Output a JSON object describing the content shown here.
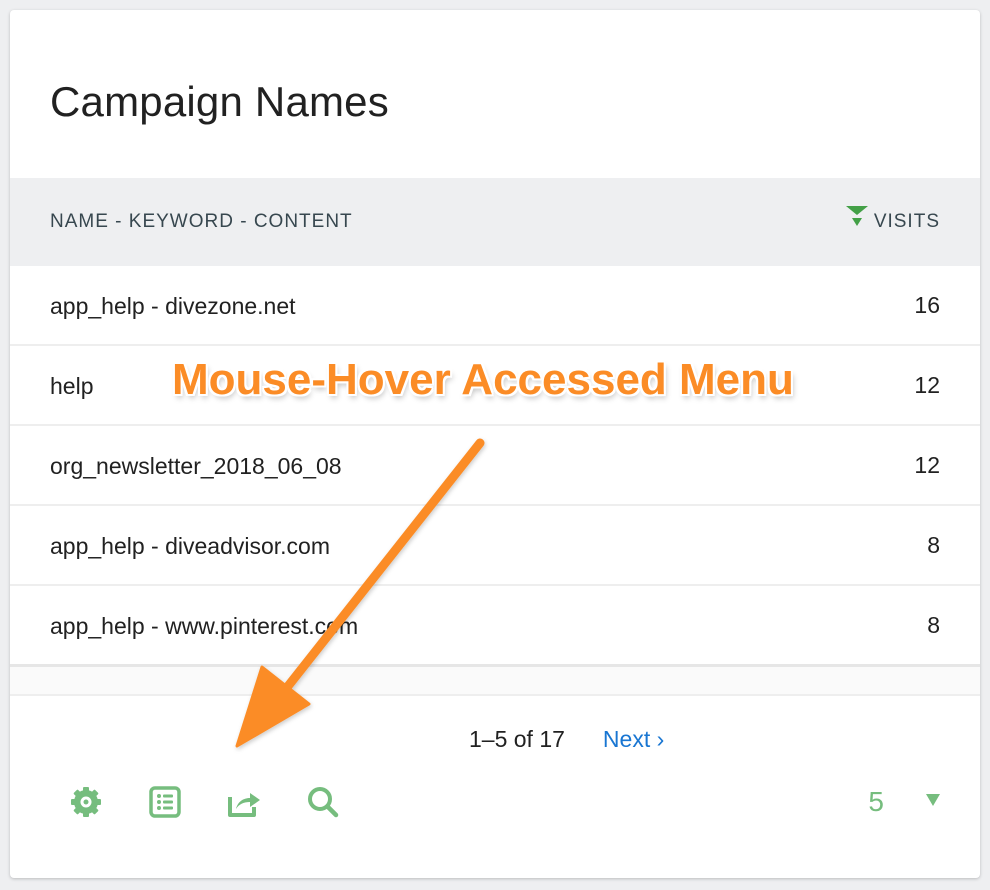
{
  "widget": {
    "title": "Campaign Names"
  },
  "table": {
    "columns": {
      "name": "NAME - KEYWORD - CONTENT",
      "visits": "VISITS"
    },
    "sort_icon": "sort-descending-icon",
    "rows": [
      {
        "name": "app_help - divezone.net",
        "visits": "16"
      },
      {
        "name": "help",
        "visits": "12"
      },
      {
        "name": "org_newsletter_2018_06_08",
        "visits": "12"
      },
      {
        "name": "app_help - diveadvisor.com",
        "visits": "8"
      },
      {
        "name": "app_help - www.pinterest.com",
        "visits": "8"
      }
    ]
  },
  "pagination": {
    "range": "1–5 of 17",
    "next_label": "Next ›"
  },
  "footer": {
    "icons": [
      {
        "name": "gear-icon",
        "label": "Settings"
      },
      {
        "name": "table-list-icon",
        "label": "Change visualization"
      },
      {
        "name": "export-icon",
        "label": "Export"
      },
      {
        "name": "search-icon",
        "label": "Search"
      }
    ],
    "limit_value": "5"
  },
  "annotation": {
    "text": "Mouse-Hover Accessed Menu"
  },
  "colors": {
    "accent_green": "#76bd7e",
    "sort_green": "#43a047",
    "link_blue": "#1976d2",
    "annotation_orange": "#fb8c26"
  }
}
